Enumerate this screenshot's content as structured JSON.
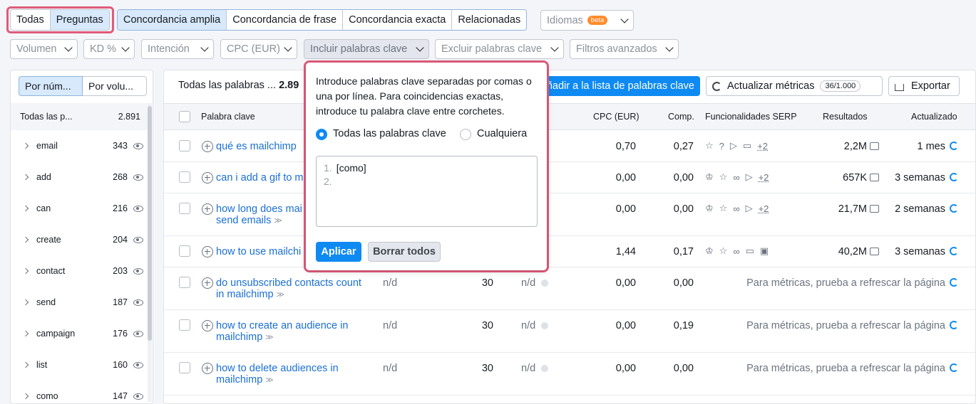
{
  "top_tabs": [
    "Todas",
    "Preguntas"
  ],
  "match_tabs": [
    "Concordancia amplia",
    "Concordancia de frase",
    "Concordancia exacta",
    "Relacionadas"
  ],
  "languages": {
    "label": "Idiomas",
    "badge": "beta"
  },
  "filters": [
    "Volumen",
    "KD %",
    "Intención",
    "CPC (EUR)",
    "Incluir palabras clave",
    "Excluir palabras clave",
    "Filtros avanzados"
  ],
  "left_panel": {
    "seg": [
      "Por núm...",
      "Por volu..."
    ],
    "header": {
      "label": "Todas las p...",
      "count": "2.891"
    },
    "items": [
      {
        "label": "email",
        "count": "343"
      },
      {
        "label": "add",
        "count": "268"
      },
      {
        "label": "can",
        "count": "216"
      },
      {
        "label": "create",
        "count": "204"
      },
      {
        "label": "contact",
        "count": "203"
      },
      {
        "label": "send",
        "count": "187"
      },
      {
        "label": "campaign",
        "count": "176"
      },
      {
        "label": "list",
        "count": "160"
      },
      {
        "label": "como",
        "count": "147"
      }
    ]
  },
  "main": {
    "summary_label": "Todas las palabras ...",
    "summary_count": "2.89",
    "add_button": "Añadir a la lista de palabras clave",
    "refresh_button": "Actualizar métricas",
    "refresh_quota": "36/1.000",
    "export_button": "Exportar",
    "columns": {
      "keyword": "Palabra clave",
      "cpc": "CPC (EUR)",
      "comp": "Comp.",
      "serp": "Funcionalidades SERP",
      "results": "Resultados",
      "updated": "Actualizado"
    },
    "rows": [
      {
        "kw1": "qué es mailchimp",
        "kw2": "",
        "vol": "",
        "kd": "",
        "cpc": "0,70",
        "comp": "0,27",
        "serp_more": "+2",
        "results": "2,2M",
        "updated": "1 mes"
      },
      {
        "kw1": "can i add a gif to m",
        "kw2": "",
        "vol": "",
        "kd": "",
        "cpc": "0,00",
        "comp": "0,00",
        "serp_more": "+2",
        "results": "657K",
        "updated": "3 semanas"
      },
      {
        "kw1": "how long does mai",
        "kw2": "send emails",
        "vol": "",
        "kd": "",
        "cpc": "0,00",
        "comp": "0,00",
        "serp_more": "+2",
        "results": "21,7M",
        "updated": "2 semanas"
      },
      {
        "kw1": "how to use mailchi",
        "kw2": "",
        "vol": "",
        "kd": "",
        "cpc": "1,44",
        "comp": "0,17",
        "serp_more": "",
        "results": "40,2M",
        "updated": "3 semanas"
      },
      {
        "kw1": "do unsubscribed contacts count",
        "kw2": "in mailchimp",
        "vol": "30",
        "kd": "n/d",
        "intent": "n/d",
        "cpc": "0,00",
        "comp": "0,00",
        "refresh_msg": "Para métricas, prueba a refrescar la página"
      },
      {
        "kw1": "how to create an audience in",
        "kw2": "mailchimp",
        "vol": "30",
        "kd": "n/d",
        "intent": "n/d",
        "cpc": "0,00",
        "comp": "0,19",
        "refresh_msg": "Para métricas, prueba a refrescar la página"
      },
      {
        "kw1": "how to delete audiences in",
        "kw2": "mailchimp",
        "vol": "30",
        "kd": "n/d",
        "intent": "n/d",
        "cpc": "0,00",
        "comp": "0,00",
        "refresh_msg": "Para métricas, prueba a refrescar la página"
      }
    ]
  },
  "popup": {
    "description": "Introduce palabras clave separadas por comas o una por línea. Para coincidencias exactas, introduce tu palabra clave entre corchetes.",
    "radio_all": "Todas las palabras clave",
    "radio_any": "Cualquiera",
    "textarea_lines": [
      "[como]",
      ""
    ],
    "apply": "Aplicar",
    "clear": "Borrar todos"
  }
}
